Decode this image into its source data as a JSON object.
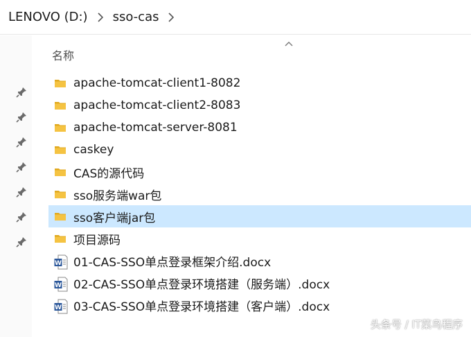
{
  "breadcrumb": [
    "LENOVO (D:)",
    "sso-cas"
  ],
  "column": {
    "name_label": "名称"
  },
  "quick_access_pins": 7,
  "files": [
    {
      "name": "apache-tomcat-client1-8082",
      "type": "folder"
    },
    {
      "name": "apache-tomcat-client2-8083",
      "type": "folder"
    },
    {
      "name": "apache-tomcat-server-8081",
      "type": "folder"
    },
    {
      "name": "caskey",
      "type": "folder"
    },
    {
      "name": "CAS的源代码",
      "type": "folder"
    },
    {
      "name": "sso服务端war包",
      "type": "folder"
    },
    {
      "name": "sso客户端jar包",
      "type": "folder",
      "selected": true
    },
    {
      "name": "项目源码",
      "type": "folder"
    },
    {
      "name": "01-CAS-SSO单点登录框架介绍.docx",
      "type": "word"
    },
    {
      "name": "02-CAS-SSO单点登录环境搭建（服务端）.docx",
      "type": "word"
    },
    {
      "name": "03-CAS-SSO单点登录环境搭建（客户端）.docx",
      "type": "word"
    }
  ],
  "watermark": "头条号 / IT菜鸟程序",
  "colors": {
    "folder": "#f5c342",
    "folder_dark": "#e0a920",
    "selected": "#cce8ff",
    "word": "#2b579a"
  }
}
